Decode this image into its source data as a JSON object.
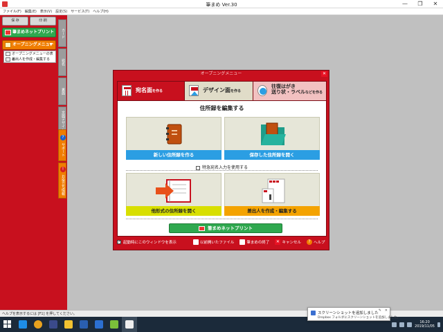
{
  "window": {
    "title": "筆まめ Ver.30",
    "controls": [
      "—",
      "❐",
      "✕"
    ]
  },
  "menubar": [
    "ファイル(F)",
    "編集(E)",
    "表示(V)",
    "設定(S)",
    "サービス(T)",
    "ヘルプ(H)"
  ],
  "left_panel": {
    "save_label": "保 存",
    "print_label": "印 刷",
    "netprint_label": "筆まめネットプリント",
    "opening_menu_label": "オープニングメニュー",
    "submenu": [
      "オープニングメニューの表示",
      "差出人を作成・編集する"
    ]
  },
  "vtabs": [
    "カード",
    "宛名",
    "裏面",
    "文面デザイン",
    "サポート",
    "お役立ち情報"
  ],
  "dialog": {
    "title": "オープニングメニュー",
    "tabs": [
      {
        "label": "宛名面",
        "suffix": "を作る"
      },
      {
        "label": "デザイン面",
        "suffix": "を作る"
      },
      {
        "label_line1": "往復はがき",
        "label_line2": "送り状・ラベル",
        "suffix": "などを作る"
      }
    ],
    "heading": "住所録を編集する",
    "cards": [
      {
        "label": "新しい住所録を作る",
        "icon": "address-book-icon"
      },
      {
        "label": "保存した住所録を開く",
        "icon": "open-folder-icon"
      },
      {
        "label": "他形式の住所録を開く",
        "icon": "import-book-icon"
      },
      {
        "label": "差出人を作成・編集する",
        "icon": "sender-card-icon"
      }
    ],
    "checkbox_label": "特急宛名入力を使用する",
    "netprint_button": "筆まめネットプリント",
    "footer": {
      "startup_checkbox": "起動時にこのウィンドウを表示",
      "recent_files": "以前開いたファイル",
      "quit": "筆まめの終了",
      "cancel": "キャンセル",
      "help": "ヘルプ"
    }
  },
  "statusbar": "ヘルプを表示するには [F1] を押してください。",
  "notification": {
    "title": "スクリーンショットを追加しました",
    "body": "Dropbox フォルダにスクリーンショットを追加しました。"
  },
  "tray": {
    "time": "16:20",
    "date": "2019/11/05"
  },
  "colors": {
    "brand_red": "#c8101e",
    "netprint_green": "#2fa84f",
    "opening_orange": "#f07d00",
    "card_blue": "#2b9ee3"
  }
}
